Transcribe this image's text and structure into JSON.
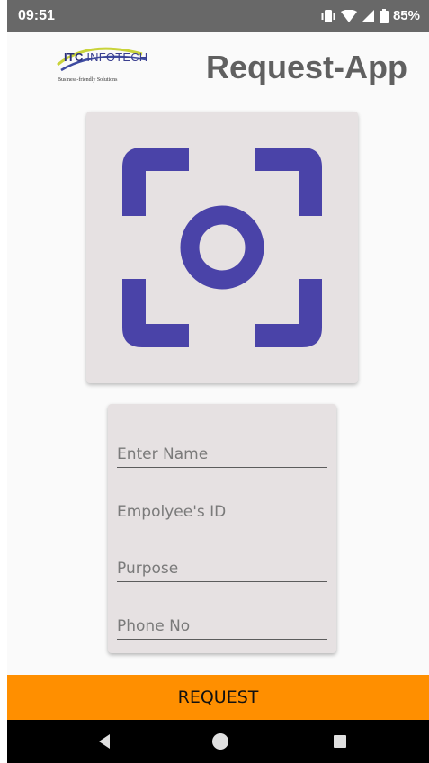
{
  "status_bar": {
    "time": "09:51",
    "battery": "85%"
  },
  "header": {
    "logo_brand_bold": "ITC",
    "logo_brand_thin": " INFOTECH",
    "logo_tagline": "Business-friendly Solutions",
    "title": "Request-App"
  },
  "camera": {
    "icon": "camera-focus-icon",
    "color": "#4a43a8"
  },
  "form": {
    "name_placeholder": "Enter Name",
    "name_value": "",
    "employee_id_placeholder": "Empolyee's ID",
    "employee_id_value": "",
    "purpose_placeholder": "Purpose",
    "purpose_value": "",
    "phone_placeholder": "Phone No",
    "phone_value": ""
  },
  "actions": {
    "request_label": "REQUEST",
    "request_color": "#ff8f00"
  },
  "nav": {
    "back_icon": "back-triangle-icon",
    "home_icon": "home-circle-icon",
    "recents_icon": "recents-square-icon"
  }
}
